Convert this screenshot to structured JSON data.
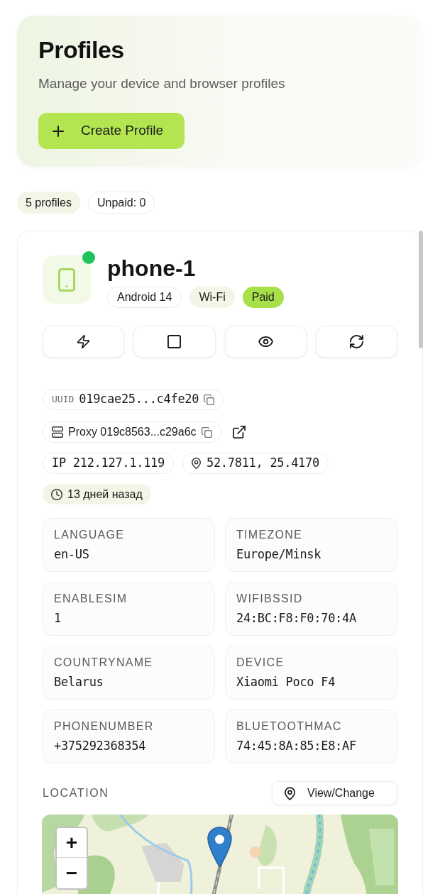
{
  "header": {
    "title": "Profiles",
    "subtitle": "Manage your device and browser profiles",
    "create_button": "Create Profile"
  },
  "summary": [
    {
      "label": "5 profiles",
      "kind": "tinted"
    },
    {
      "label": "Unpaid: 0",
      "kind": "outlined"
    }
  ],
  "profile": {
    "name": "phone-1",
    "online": true,
    "badges": [
      {
        "label": "Android 14",
        "kind": "outlined"
      },
      {
        "label": "Wi-Fi",
        "kind": "tinted"
      },
      {
        "label": "Paid",
        "kind": "accent"
      }
    ],
    "uuid": {
      "label": "UUID",
      "value": "019cae25...c4fe20"
    },
    "proxy": "Proxy 019c8563...c29a6c",
    "ip": "IP 212.127.1.119",
    "coordinates": "52.7811, 25.4170",
    "created": "13 дней назад",
    "fields": [
      {
        "label": "LANGUAGE",
        "value": "en-US"
      },
      {
        "label": "TIMEZONE",
        "value": "Europe/Minsk"
      },
      {
        "label": "ENABLESIM",
        "value": "1"
      },
      {
        "label": "WIFIBSSID",
        "value": "24:BC:F8:F0:70:4A"
      },
      {
        "label": "COUNTRYNAME",
        "value": "Belarus"
      },
      {
        "label": "DEVICE",
        "value": "Xiaomi Poco F4"
      },
      {
        "label": "PHONENUMBER",
        "value": "+375292368354"
      },
      {
        "label": "BLUETOOTHMAC",
        "value": "74:45:8A:85:E8:AF"
      }
    ],
    "location": {
      "label": "LOCATION",
      "button": "View/Change",
      "map": {
        "zoom_in": "+",
        "zoom_out": "−"
      }
    }
  }
}
